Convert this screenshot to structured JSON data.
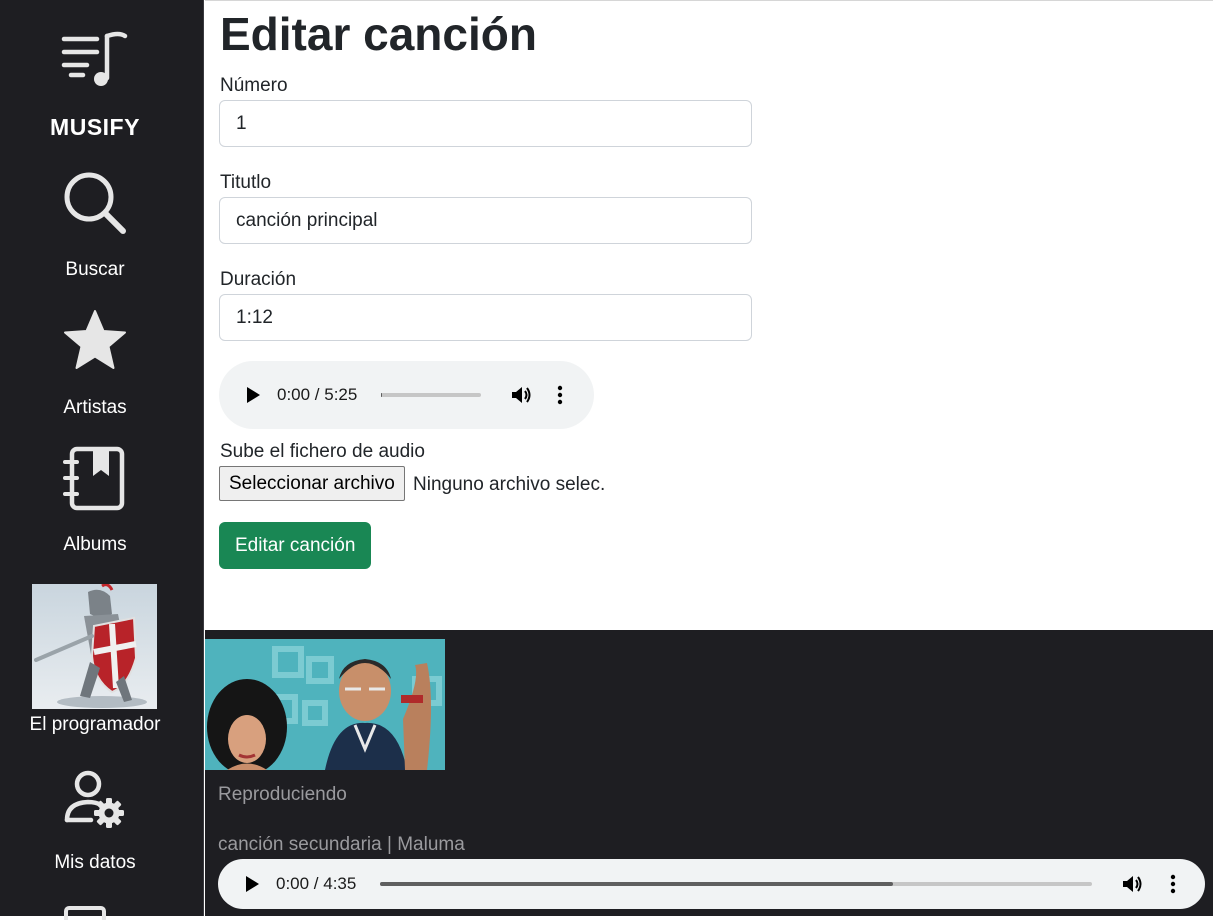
{
  "sidebar": {
    "brand": {
      "label": "MUSIFY",
      "icon": "music-queue-icon"
    },
    "items": [
      {
        "label": "Buscar",
        "icon": "search-icon"
      },
      {
        "label": "Artistas",
        "icon": "star-icon"
      },
      {
        "label": "Albums",
        "icon": "album-book-icon"
      },
      {
        "label": "El programador",
        "icon": "user-avatar"
      },
      {
        "label": "Mis datos",
        "icon": "user-gear-icon"
      }
    ]
  },
  "form": {
    "title": "Editar canción",
    "number": {
      "label": "Número",
      "value": "1"
    },
    "title_field": {
      "label": "Titutlo",
      "value": "canción principal"
    },
    "duration": {
      "label": "Duración",
      "value": "1:12"
    },
    "audio": {
      "time": "0:00 / 5:25",
      "progress": 0
    },
    "file": {
      "label": "Sube el fichero de audio",
      "button": "Seleccionar archivo",
      "status": "Ninguno archivo selec."
    },
    "submit": "Editar canción"
  },
  "player": {
    "status": "Reproduciendo",
    "track": "canción secundaria | Maluma",
    "time": "0:00 / 4:35",
    "progress": 0.72
  },
  "colors": {
    "sidebar_bg": "#1e1e22",
    "success": "#198754",
    "player_text": "#9a9a9e"
  }
}
